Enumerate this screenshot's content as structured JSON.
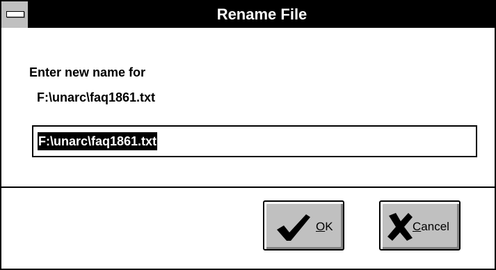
{
  "window": {
    "title": "Rename File"
  },
  "dialog": {
    "prompt": "Enter new name for",
    "current_path": "F:\\unarc\\faq1861.txt",
    "new_name_value": "F:\\unarc\\faq1861.txt"
  },
  "buttons": {
    "ok": {
      "mnemonic": "O",
      "rest": "K",
      "icon": "checkmark-icon"
    },
    "cancel": {
      "mnemonic": "C",
      "rest": "ancel",
      "icon": "x-mark-icon"
    }
  },
  "colors": {
    "titlebar": "#000000",
    "title_text": "#ffffff",
    "button_face": "#c0c0c0",
    "selection": "#000000"
  }
}
